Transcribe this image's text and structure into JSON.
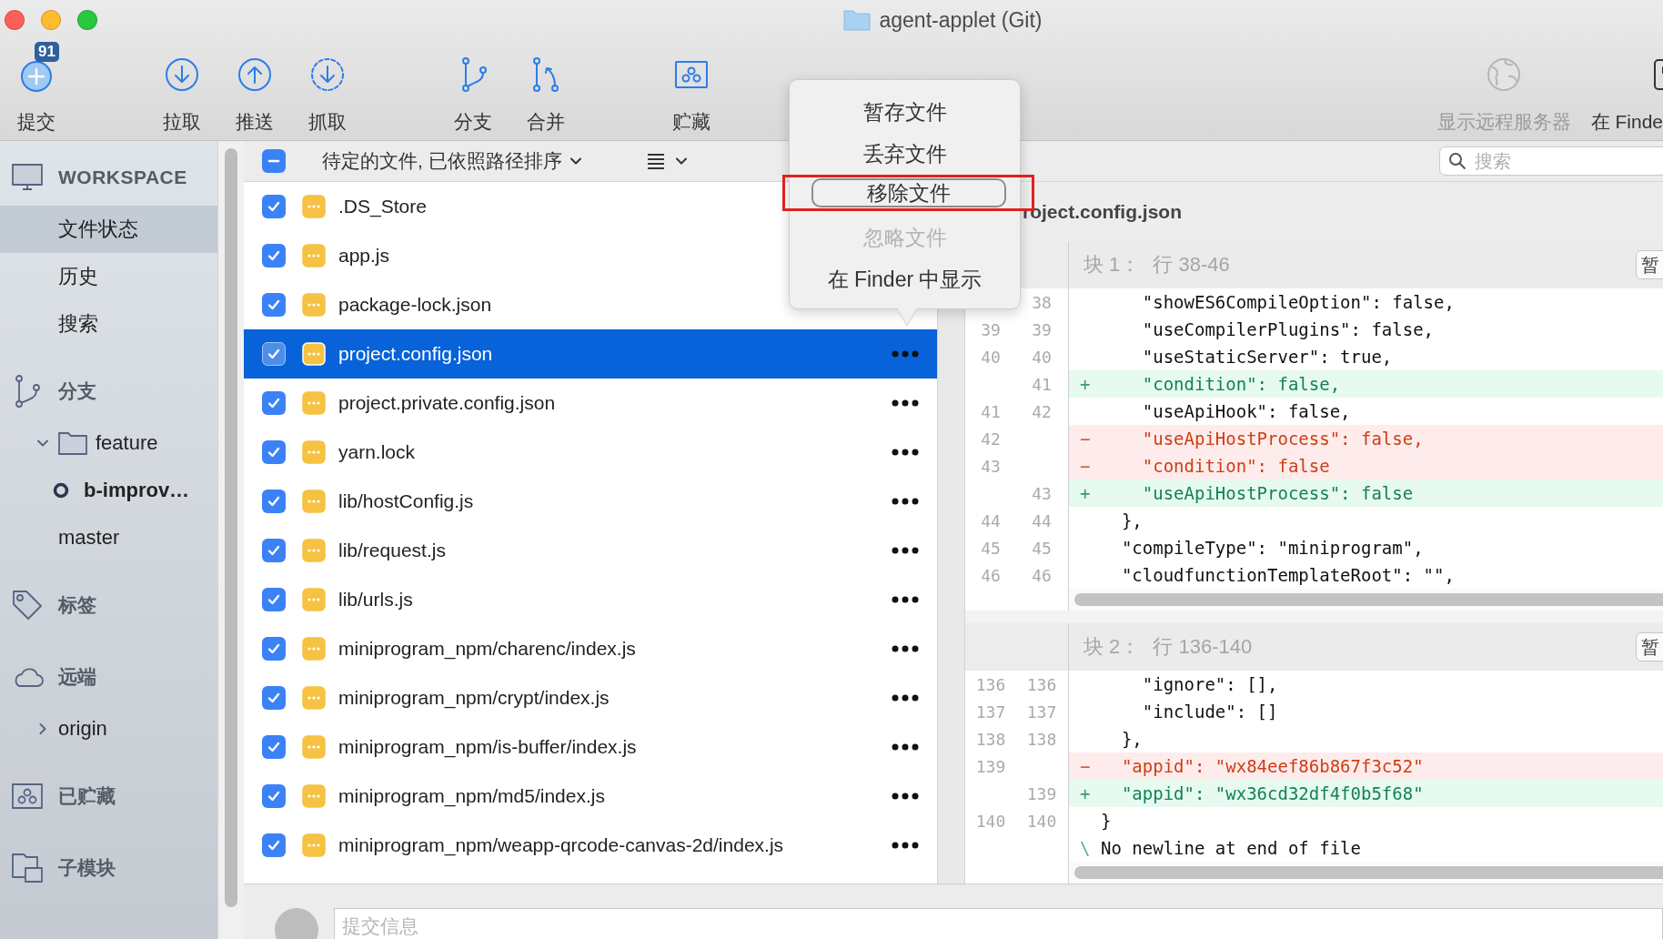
{
  "window": {
    "title": "agent-applet (Git)"
  },
  "toolbar": {
    "groups": [
      [
        {
          "label": "提交",
          "badge": "91",
          "disabled": false
        }
      ],
      [
        {
          "label": "拉取",
          "disabled": false
        },
        {
          "label": "推送",
          "disabled": false
        },
        {
          "label": "抓取",
          "disabled": false
        }
      ],
      [
        {
          "label": "分支",
          "disabled": false
        },
        {
          "label": "合并",
          "disabled": false
        }
      ],
      [
        {
          "label": "贮藏",
          "disabled": false
        }
      ]
    ],
    "right": [
      {
        "label": "显示远程服务器",
        "disabled": true
      },
      {
        "label": "在 Finde",
        "disabled": false
      }
    ]
  },
  "sidebar": {
    "sections": [
      {
        "title": "WORKSPACE",
        "items": [
          {
            "label": "文件状态",
            "kind": "view",
            "selected": true
          },
          {
            "label": "历史",
            "kind": "view",
            "selected": false
          },
          {
            "label": "搜索",
            "kind": "view",
            "selected": false
          }
        ]
      },
      {
        "title": "分支",
        "items": [
          {
            "label": "feature",
            "kind": "folder",
            "expanded": true,
            "children": [
              {
                "label": "b-improv…",
                "kind": "branch",
                "current": true
              }
            ]
          },
          {
            "label": "master",
            "kind": "branch",
            "current": false
          }
        ]
      },
      {
        "title": "标签"
      },
      {
        "title": "远端",
        "items": [
          {
            "label": "origin",
            "kind": "remote",
            "expanded": false
          }
        ]
      },
      {
        "title": "已贮藏"
      },
      {
        "title": "子模块"
      }
    ]
  },
  "file_list": {
    "select_all": {
      "checked": true,
      "indeterminate": true
    },
    "sort_label": "待定的文件, 已依照路径排序",
    "files": [
      {
        "name": ".DS_Store",
        "checked": true,
        "selected": false,
        "more": false
      },
      {
        "name": "app.js",
        "checked": true,
        "selected": false,
        "more": false
      },
      {
        "name": "package-lock.json",
        "checked": true,
        "selected": false,
        "more": false
      },
      {
        "name": "project.config.json",
        "checked": true,
        "selected": true,
        "more": true
      },
      {
        "name": "project.private.config.json",
        "checked": true,
        "selected": false,
        "more": true
      },
      {
        "name": "yarn.lock",
        "checked": true,
        "selected": false,
        "more": true
      },
      {
        "name": "lib/hostConfig.js",
        "checked": true,
        "selected": false,
        "more": true
      },
      {
        "name": "lib/request.js",
        "checked": true,
        "selected": false,
        "more": true
      },
      {
        "name": "lib/urls.js",
        "checked": true,
        "selected": false,
        "more": true
      },
      {
        "name": "miniprogram_npm/charenc/index.js",
        "checked": true,
        "selected": false,
        "more": true
      },
      {
        "name": "miniprogram_npm/crypt/index.js",
        "checked": true,
        "selected": false,
        "more": true
      },
      {
        "name": "miniprogram_npm/is-buffer/index.js",
        "checked": true,
        "selected": false,
        "more": true
      },
      {
        "name": "miniprogram_npm/md5/index.js",
        "checked": true,
        "selected": false,
        "more": true
      },
      {
        "name": "miniprogram_npm/weapp-qrcode-canvas-2d/index.js",
        "checked": true,
        "selected": false,
        "more": true
      }
    ]
  },
  "context_menu": {
    "items": [
      {
        "label": "暂存文件",
        "disabled": false,
        "focused": false,
        "annotated": false
      },
      {
        "label": "丢弃文件",
        "disabled": false,
        "focused": false,
        "annotated": false
      },
      {
        "label": "移除文件",
        "disabled": false,
        "focused": true,
        "annotated": true
      },
      {
        "label": "忽略文件",
        "disabled": true,
        "focused": false,
        "annotated": false
      },
      {
        "label": "在 Finder 中显示",
        "disabled": false,
        "focused": false,
        "annotated": false
      }
    ]
  },
  "diff": {
    "search": {
      "placeholder": "搜索"
    },
    "file": "roject.config.json",
    "hunks": [
      {
        "title": "块 1：",
        "range": "行 38-46",
        "button": "暂",
        "lines": [
          {
            "new": "38",
            "kind": "context",
            "code": "    \"showES6CompileOption\": false,"
          },
          {
            "old": "39",
            "new": "39",
            "kind": "context",
            "code": "    \"useCompilerPlugins\": false,"
          },
          {
            "old": "40",
            "new": "40",
            "kind": "context",
            "code": "    \"useStaticServer\": true,"
          },
          {
            "new": "41",
            "kind": "added",
            "sign": "+",
            "code": "    \"condition\": false,"
          },
          {
            "old": "41",
            "new": "42",
            "kind": "context",
            "code": "    \"useApiHook\": false,"
          },
          {
            "old": "42",
            "kind": "removed",
            "sign": "−",
            "code": "    \"useApiHostProcess\": false,"
          },
          {
            "old": "43",
            "kind": "removed",
            "sign": "−",
            "code": "    \"condition\": false"
          },
          {
            "new": "43",
            "kind": "added",
            "sign": "+",
            "code": "    \"useApiHostProcess\": false"
          },
          {
            "old": "44",
            "new": "44",
            "kind": "context",
            "code": "  },"
          },
          {
            "old": "45",
            "new": "45",
            "kind": "context",
            "code": "  \"compileType\": \"miniprogram\","
          },
          {
            "old": "46",
            "new": "46",
            "kind": "context",
            "code": "  \"cloudfunctionTemplateRoot\": \"\","
          }
        ]
      },
      {
        "title": "块 2：",
        "range": "行 136-140",
        "button": "暂",
        "lines": [
          {
            "old": "136",
            "new": "136",
            "kind": "context",
            "code": "    \"ignore\": [],"
          },
          {
            "old": "137",
            "new": "137",
            "kind": "context",
            "code": "    \"include\": []"
          },
          {
            "old": "138",
            "new": "138",
            "kind": "context",
            "code": "  },"
          },
          {
            "old": "139",
            "kind": "removed",
            "sign": "−",
            "code": "  \"appid\": \"wx84eef86b867f3c52\""
          },
          {
            "new": "139",
            "kind": "added",
            "sign": "+",
            "code": "  \"appid\": \"wx36cd32df4f0b5f68\""
          },
          {
            "old": "140",
            "new": "140",
            "kind": "context",
            "code": "}"
          },
          {
            "kind": "note",
            "sign": "\\",
            "code": "No newline at end of file"
          }
        ]
      }
    ]
  },
  "commit": {
    "placeholder": "提交信息"
  }
}
